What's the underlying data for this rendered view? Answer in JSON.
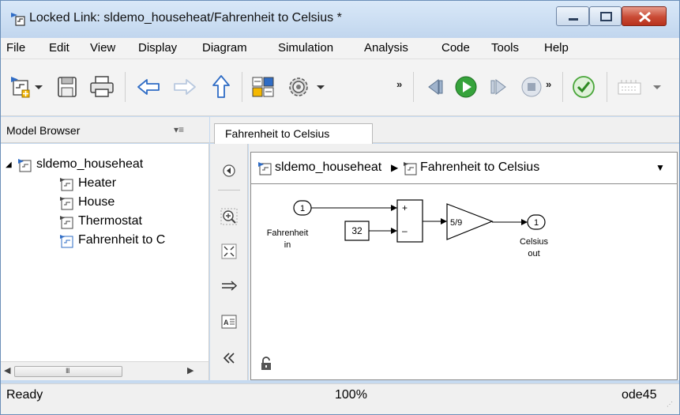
{
  "window": {
    "title": "Locked Link: sldemo_househeat/Fahrenheit to Celsius  *"
  },
  "menu": [
    "File",
    "Edit",
    "View",
    "Display",
    "Diagram",
    "Simulation",
    "Analysis",
    "Code",
    "Tools",
    "Help"
  ],
  "toolbar": {
    "icons": [
      "new-model-icon",
      "save-icon",
      "print-icon",
      "back-icon",
      "forward-icon",
      "up-icon",
      "library-browser-icon",
      "settings-icon",
      "step-back-icon",
      "run-icon",
      "step-forward-icon",
      "stop-icon",
      "check-icon",
      "grid-icon"
    ],
    "overflow_label": "»"
  },
  "model_browser": {
    "title": "Model Browser",
    "menu_glyph": "▾≡",
    "tree": [
      {
        "label": "sldemo_househeat",
        "level": 0,
        "expanded": true
      },
      {
        "label": "Heater",
        "level": 1
      },
      {
        "label": "House",
        "level": 1
      },
      {
        "label": "Thermostat",
        "level": 1
      },
      {
        "label": "Fahrenheit to C",
        "level": 1,
        "selected": true
      }
    ],
    "scroll_grip": "III"
  },
  "editor": {
    "tab_label": "Fahrenheit to Celsius",
    "breadcrumb": [
      "sldemo_househeat",
      "Fahrenheit to Celsius"
    ],
    "palette": [
      "hide-browser-icon",
      "zoom-icon",
      "fit-view-icon",
      "arrow-icon",
      "annotation-icon",
      "collapse-icon"
    ]
  },
  "diagram": {
    "inport_number": "1",
    "inport_label_1": "Fahrenheit",
    "inport_label_2": "in",
    "constant_value": "32",
    "sum_plus": "+",
    "sum_minus": "–",
    "gain_value": "5/9",
    "outport_number": "1",
    "outport_label_1": "Celsius",
    "outport_label_2": "out"
  },
  "status": {
    "state": "Ready",
    "zoom": "100%",
    "solver": "ode45"
  },
  "colors": {
    "title_bar": "#c6daf0",
    "close_button": "#c94b35",
    "run_button": "#36a33b",
    "check_button": "#4aa63b",
    "arrow_blue": "#2f6cc5"
  }
}
